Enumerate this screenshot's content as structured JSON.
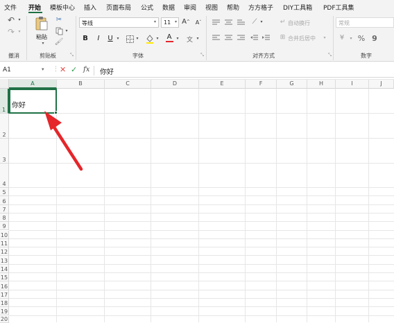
{
  "tabs": [
    "文件",
    "开始",
    "模板中心",
    "插入",
    "页面布局",
    "公式",
    "数据",
    "审阅",
    "视图",
    "帮助",
    "方方格子",
    "DIY工具箱",
    "PDF工具集"
  ],
  "ribbon": {
    "undo_label": "撤消",
    "paste_label": "粘贴",
    "clipboard_label": "剪贴板",
    "font_name": "等线",
    "font_size": "11",
    "grow_font": "A",
    "shrink_font": "A",
    "bold": "B",
    "italic": "I",
    "underline": "U",
    "font_color_letter": "A",
    "font_group_label": "字体",
    "wrap_text": "自动换行",
    "merge_center": "合并后居中",
    "align_group_label": "对齐方式",
    "number_format": "常规",
    "percent": "%",
    "comma": "9",
    "number_group_label": "数字"
  },
  "formula_bar": {
    "name_box": "A1",
    "fx": "fx",
    "content": "你好"
  },
  "columns": [
    "A",
    "B",
    "C",
    "D",
    "E",
    "F",
    "G",
    "H",
    "I",
    "J"
  ],
  "rows": [
    "1",
    "2",
    "3",
    "4",
    "5",
    "6",
    "7",
    "8",
    "9",
    "10",
    "11",
    "12",
    "13",
    "14",
    "15",
    "16",
    "17",
    "18",
    "19",
    "20"
  ],
  "cell_a1": "你好",
  "colors": {
    "accent": "#1e7145",
    "arrow": "#e5262a",
    "font_color_bar": "#e5262a"
  }
}
